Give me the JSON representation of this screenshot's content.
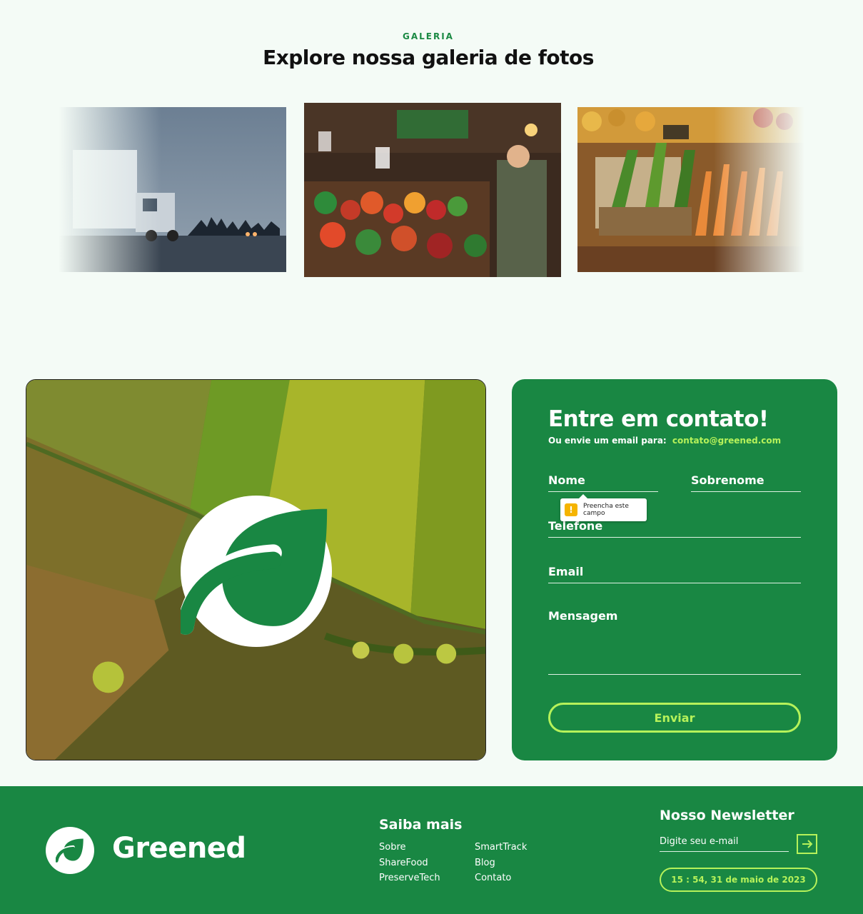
{
  "gallery": {
    "eyebrow": "GALERIA",
    "title": "Explore nossa galeria de fotos",
    "photos": [
      "truck-on-road-photo",
      "market-stall-photo",
      "vegetables-photo"
    ]
  },
  "contact": {
    "title": "Entre em contato!",
    "subtitle": "Ou envie um email para:",
    "email": "contato@greened.com",
    "fields": {
      "nome": "Nome",
      "sobrenome": "Sobrenome",
      "telefone": "Telefone",
      "email": "Email",
      "mensagem": "Mensagem"
    },
    "tooltip": "Preencha este campo",
    "submit": "Enviar"
  },
  "footer": {
    "brand": "Greened",
    "saiba_title": "Saiba mais",
    "links": [
      "Sobre",
      "ShareFood",
      "PreserveTech",
      "SmartTrack",
      "Blog",
      "Contato"
    ],
    "newsletter_title": "Nosso Newsletter",
    "newsletter_placeholder": "Digite seu e-mail",
    "clock": "15 : 54, 31 de maio de 2023"
  },
  "colors": {
    "brand_green": "#198743",
    "accent_lime": "#b6f25a",
    "background": "#f4fbf6"
  },
  "icons": {
    "leaf": "leaf-icon",
    "arrow": "arrow-right-icon",
    "warning": "warning-icon"
  }
}
